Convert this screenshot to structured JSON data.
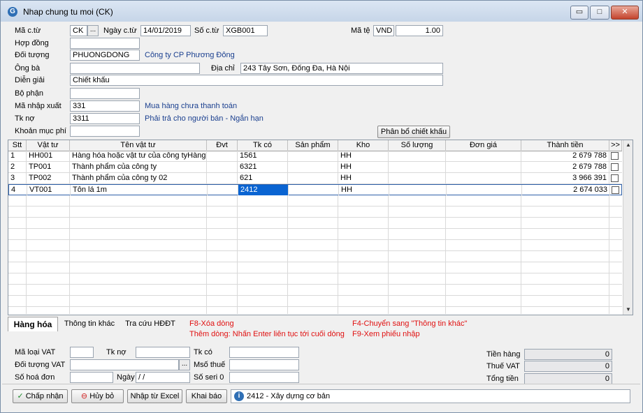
{
  "window": {
    "title": "Nhap chung tu moi (CK)",
    "app_icon": "G",
    "minimize": "▭",
    "maximize": "□",
    "close": "✕"
  },
  "header": {
    "ma_ct_label": "Mã c.từ",
    "ma_ct_value": "CK",
    "ellipsis": "...",
    "ngay_ct_label": "Ngày c.từ",
    "ngay_ct_value": "14/01/2019",
    "so_ct_label": "Số c.từ",
    "so_ct_value": "XGB001",
    "ma_te_label": "Mã tệ",
    "ma_te_value": "VND",
    "ty_gia_value": "1.00",
    "hop_dong_label": "Hợp đồng",
    "hop_dong_value": "",
    "doi_tuong_label": "Đối tượng",
    "doi_tuong_value": "PHUONGDONG",
    "doi_tuong_name": "Công ty CP Phương Đông",
    "ong_ba_label": "Ông bà",
    "ong_ba_value": "",
    "dia_chi_label": "Địa chỉ",
    "dia_chi_value": "243 Tây Sơn, Đống Đa, Hà Nội",
    "dien_giai_label": "Diễn giải",
    "dien_giai_value": "Chiết khấu",
    "bo_phan_label": "Bộ phận",
    "bo_phan_value": "",
    "ma_nhap_xuat_label": "Mã nhập xuất",
    "ma_nhap_xuat_value": "331",
    "ma_nhap_xuat_desc": "Mua hàng chưa thanh toán",
    "tk_no_label": "Tk nợ",
    "tk_no_value": "3311",
    "tk_no_desc": "Phải trả cho người bán - Ngắn hạn",
    "khoan_muc_phi_label": "Khoản mục phí",
    "khoan_muc_phi_value": "",
    "phan_bo_button": "Phân bổ chiết khấu"
  },
  "grid": {
    "columns": [
      "Stt",
      "Vật tư",
      "Tên vật tư",
      "Đvt",
      "Tk có",
      "Sản phẩm",
      "Kho",
      "Số lượng",
      "Đơn giá",
      "Thành tiền",
      ">>"
    ],
    "rows": [
      {
        "stt": "1",
        "vat_tu": "HH001",
        "ten": "Hàng hóa hoặc vật tư của công tyHàng",
        "dvt": "",
        "tk_co": "1561",
        "san_pham": "",
        "kho": "HH",
        "so_luong": "",
        "don_gia": "",
        "thanh_tien": "2 679 788"
      },
      {
        "stt": "2",
        "vat_tu": "TP001",
        "ten": "Thành phẩm của công ty",
        "dvt": "",
        "tk_co": "6321",
        "san_pham": "",
        "kho": "HH",
        "so_luong": "",
        "don_gia": "",
        "thanh_tien": "2 679 788"
      },
      {
        "stt": "3",
        "vat_tu": "TP002",
        "ten": "Thành phẩm của công ty 02",
        "dvt": "",
        "tk_co": "621",
        "san_pham": "",
        "kho": "HH",
        "so_luong": "",
        "don_gia": "",
        "thanh_tien": "3 966 391"
      },
      {
        "stt": "4",
        "vat_tu": "VT001",
        "ten": "Tôn lá 1m",
        "dvt": "",
        "tk_co": "2412",
        "san_pham": "",
        "kho": "HH",
        "so_luong": "",
        "don_gia": "",
        "thanh_tien": "2 674 033"
      }
    ]
  },
  "tabs": [
    {
      "label": "Hàng hóa"
    },
    {
      "label": "Thông tin khác"
    },
    {
      "label": "Tra cứu HĐĐT"
    }
  ],
  "hints": {
    "f8": "F8-Xóa dòng",
    "them_dong": "Thêm dòng: Nhấn Enter liên tục tới cuối dòng",
    "f4": "F4-Chuyển sang \"Thông tin khác\"",
    "f9": "F9-Xem phiếu nhập"
  },
  "vat": {
    "ma_loai_vat_label": "Mã loại VAT",
    "ma_loai_vat_value": "",
    "tk_no_label": "Tk nợ",
    "tk_no_value": "",
    "tk_co_label": "Tk có",
    "tk_co_value": "",
    "doi_tuong_vat_label": "Đối tượng VAT",
    "doi_tuong_vat_value": "",
    "mso_thue_label": "Msố thuế",
    "mso_thue_value": "",
    "so_hoa_don_label": "Số hoá đơn",
    "so_hoa_don_value": "",
    "ngay_label": "Ngày",
    "ngay_value": " /  /",
    "so_seri_label": "Số seri 0",
    "so_seri_value": ""
  },
  "totals": {
    "tien_hang_label": "Tiền hàng",
    "tien_hang_value": "0",
    "thue_vat_label": "Thuế VAT",
    "thue_vat_value": "0",
    "tong_tien_label": "Tổng tiền",
    "tong_tien_value": "0"
  },
  "footer": {
    "chap_nhan": "Chấp nhận",
    "huy_bo": "Hủy bỏ",
    "nhap_tu_excel": "Nhập từ Excel",
    "khai_bao": "Khai báo",
    "status_text": "2412 - Xây dựng cơ bản"
  },
  "colors": {
    "accent": "#0a64d2",
    "description_text": "#1a3f8f",
    "hint_text": "#e01010"
  }
}
